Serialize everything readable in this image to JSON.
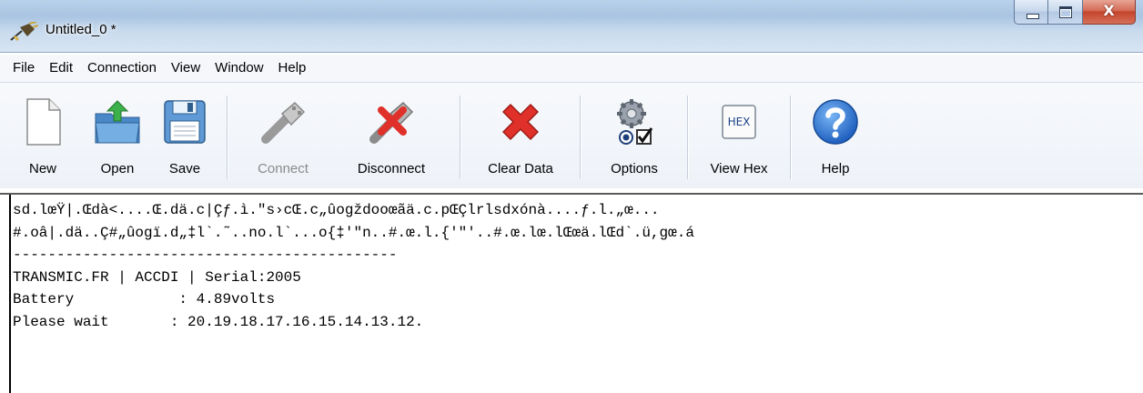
{
  "window": {
    "title": "Untitled_0 *",
    "close_glyph": "X"
  },
  "menu": {
    "items": [
      "File",
      "Edit",
      "Connection",
      "View",
      "Window",
      "Help"
    ]
  },
  "toolbar": {
    "new_label": "New",
    "open_label": "Open",
    "save_label": "Save",
    "connect_label": "Connect",
    "disconnect_label": "Disconnect",
    "clear_label": "Clear Data",
    "options_label": "Options",
    "viewhex_label": "View Hex",
    "hex_icon_text": "HEX",
    "help_label": "Help",
    "connect_enabled": false
  },
  "terminal": {
    "lines": [
      "sd.lœŸ|.Œdà<....Œ.dä.c|Çƒ.ì.\"s›cŒ.c„ûogždooœãä.c.pŒÇlrlsdxónà....ƒ.l.„œ...",
      "#.oâ|.dä..Ç#„ûogï.d„‡l`.˜..no.l`...o{‡'\"n..#.œ.l.{'\"'..#.œ.lœ.lŒœä.lŒd`.ü,gœ.á",
      "--------------------------------------------",
      "TRANSMIC.FR | ACCDI | Serial:2005",
      "Battery            : 4.89volts",
      "Please wait       : 20.19.18.17.16.15.14.13.12."
    ]
  },
  "colors": {
    "titlebar": "#b9d1ea",
    "close_button": "#c4442b",
    "help_icon": "#2a6fcf",
    "clear_icon": "#e0302a"
  }
}
